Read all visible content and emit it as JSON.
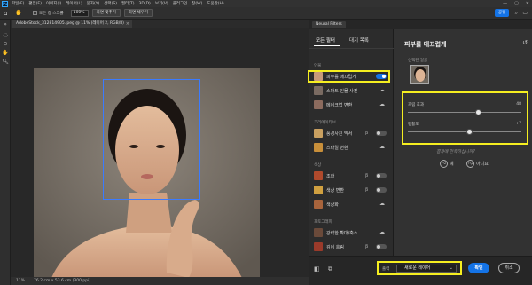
{
  "menubar": {
    "logo": "Ps",
    "items": [
      "파일(F)",
      "편집(E)",
      "이미지(I)",
      "레이어(L)",
      "문자(Y)",
      "선택(S)",
      "필터(T)",
      "3D(D)",
      "보기(V)",
      "플러그인",
      "창(W)",
      "도움말(H)"
    ],
    "controls": [
      "—",
      "▢",
      "✕"
    ]
  },
  "options": {
    "check_label": "모든 창 스크롤",
    "zoom_value": "100%",
    "btn_fit": "화면 맞추기",
    "btn_fill": "화면 채우기",
    "share_label": "공유"
  },
  "document": {
    "tab_title": "AdobeStock_312814905.jpeg @ 11% (레이어 2, RGB/8)",
    "close_glyph": "×"
  },
  "status": {
    "zoom": "11%",
    "dimensions": "76.2 cm x 53.6 cm (300 ppi)"
  },
  "neural_filters": {
    "header_tab": "Neural Filters",
    "tab_all": "모든 필터",
    "tab_waitlist": "대기 목록",
    "sections": {
      "portrait": "인물",
      "creative": "크리에이티브",
      "color": "색상",
      "photography": "포토그래피"
    },
    "items": [
      {
        "label": "피부를 매끄럽게",
        "toggle": "on"
      },
      {
        "label": "스마트 인물 사진",
        "toggle": "cloud"
      },
      {
        "label": "메이크업 변환",
        "toggle": "cloud"
      },
      {
        "label": "풍경사진 믹서",
        "badge": "β",
        "toggle": "off"
      },
      {
        "label": "스타일 변환",
        "toggle": "cloud"
      },
      {
        "label": "조화",
        "badge": "β",
        "toggle": "off"
      },
      {
        "label": "색상 변환",
        "badge": "β",
        "toggle": "off"
      },
      {
        "label": "색상화",
        "toggle": "cloud"
      },
      {
        "label": "강력한 확대/축소",
        "toggle": "cloud"
      },
      {
        "label": "깊이 흐림",
        "badge": "β",
        "toggle": "off"
      }
    ]
  },
  "settings": {
    "title": "피부를 매끄럽게",
    "selected_face_label": "선택된 얼굴",
    "blur": {
      "label": "흐림 효과",
      "value": "48",
      "position": 0.62
    },
    "smoothness": {
      "label": "평활도",
      "value": "+7",
      "position": 0.54
    },
    "question": "결과에 만족하십니까?",
    "yes": "예",
    "no": "아니요"
  },
  "bottom": {
    "output_label": "출력",
    "output_value": "새로운 레이어",
    "ok": "확인",
    "cancel": "취소"
  },
  "colors": {
    "accent": "#1473e6",
    "highlight": "#f5ee20",
    "face_frame": "#3b7bff"
  }
}
